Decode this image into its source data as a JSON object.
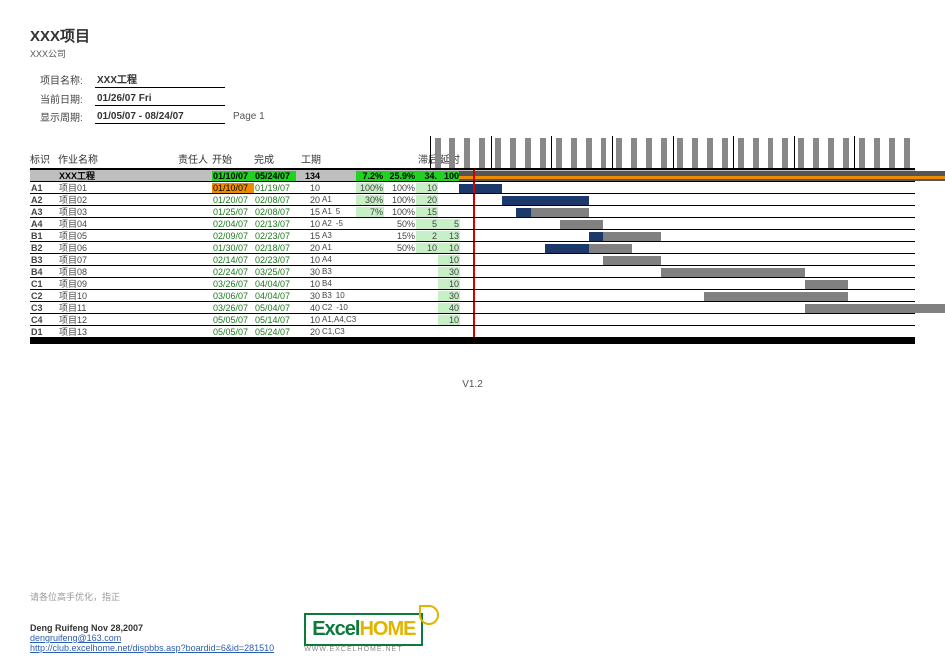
{
  "header": {
    "title": "XXX项目",
    "subtitle": "XXX公司",
    "fields": {
      "project_label": "项目名称:",
      "project_value": "XXX工程",
      "today_label": "当前日期:",
      "today_value": "01/26/07  Fri",
      "range_label": "显示周期:",
      "range_value": "01/05/07 - 08/24/07",
      "page": "Page 1"
    }
  },
  "columns": {
    "id": "标识",
    "name": "作业名称",
    "res": "责任人",
    "start": "开始",
    "end": "完成",
    "dur": "工期",
    "dep": "",
    "plan": "",
    "act": "",
    "rem": "滞后",
    "late": "延时"
  },
  "summary": {
    "name": "XXX工程",
    "start": "01/10/07",
    "end": "05/24/07",
    "dur": "134",
    "plan": "7.2%",
    "act": "25.9%",
    "rem": "34.",
    "late": "100"
  },
  "rows": [
    {
      "id": "A1",
      "name": "项目01",
      "start": "01/10/07",
      "end": "01/19/07",
      "dur": "10",
      "dep": "",
      "plan": "100%",
      "act": "100%",
      "rem": "10",
      "late": "",
      "orange_start": true,
      "bar_s": 2,
      "bar_e": 5,
      "done": 5
    },
    {
      "id": "A2",
      "name": "项目02",
      "start": "01/20/07",
      "end": "02/08/07",
      "dur": "20",
      "dep": "A1",
      "plan": "30%",
      "act": "100%",
      "rem": "20",
      "late": "",
      "bar_s": 5,
      "bar_e": 11,
      "done": 11
    },
    {
      "id": "A3",
      "name": "项目03",
      "start": "01/25/07",
      "end": "02/08/07",
      "dur": "15",
      "dep": "A1",
      "plan": "7%",
      "sub": "5",
      "act": "100%",
      "rem": "15",
      "late": "",
      "bar_s": 6,
      "bar_e": 11,
      "done": 7
    },
    {
      "id": "A4",
      "name": "项目04",
      "start": "02/04/07",
      "end": "02/13/07",
      "dur": "10",
      "dep": "A2",
      "sub": "-5",
      "plan": "",
      "act": "50%",
      "rem": "5",
      "late": "5",
      "bar_s": 9,
      "bar_e": 12,
      "done": 0
    },
    {
      "id": "B1",
      "name": "项目05",
      "start": "02/09/07",
      "end": "02/23/07",
      "dur": "15",
      "dep": "A3",
      "plan": "",
      "act": "15%",
      "rem": "2",
      "late": "13",
      "bar_s": 11,
      "bar_e": 16,
      "done": 11,
      "done_e": 12
    },
    {
      "id": "B2",
      "name": "项目06",
      "start": "01/30/07",
      "end": "02/18/07",
      "dur": "20",
      "dep": "A1",
      "plan": "",
      "act": "50%",
      "rem": "10",
      "late": "10",
      "bar_s": 8,
      "bar_e": 14,
      "done": 8,
      "done_e": 11
    },
    {
      "id": "B3",
      "name": "项目07",
      "start": "02/14/07",
      "end": "02/23/07",
      "dur": "10",
      "dep": "A4",
      "plan": "",
      "act": "",
      "rem": "",
      "late": "10",
      "bar_s": 12,
      "bar_e": 16
    },
    {
      "id": "B4",
      "name": "项目08",
      "start": "02/24/07",
      "end": "03/25/07",
      "dur": "30",
      "dep": "B3",
      "plan": "",
      "act": "",
      "rem": "",
      "late": "30",
      "bar_s": 16,
      "bar_e": 26
    },
    {
      "id": "C1",
      "name": "项目09",
      "start": "03/26/07",
      "end": "04/04/07",
      "dur": "10",
      "dep": "B4",
      "plan": "",
      "act": "",
      "rem": "",
      "late": "10",
      "bar_s": 26,
      "bar_e": 29
    },
    {
      "id": "C2",
      "name": "项目10",
      "start": "03/06/07",
      "end": "04/04/07",
      "dur": "30",
      "dep": "B3",
      "sub": "10",
      "plan": "",
      "act": "",
      "rem": "",
      "late": "30",
      "bar_s": 19,
      "bar_e": 29
    },
    {
      "id": "C3",
      "name": "项目11",
      "start": "03/26/07",
      "end": "05/04/07",
      "dur": "40",
      "dep": "C2",
      "sub": "-10",
      "plan": "",
      "act": "",
      "rem": "",
      "late": "40",
      "bar_s": 26,
      "bar_e": 40
    },
    {
      "id": "C4",
      "name": "项目12",
      "start": "05/05/07",
      "end": "05/14/07",
      "dur": "10",
      "dep": "A1,A4,C3",
      "plan": "",
      "act": "",
      "rem": "",
      "late": "10",
      "bar_s": 40,
      "bar_e": 43
    },
    {
      "id": "D1",
      "name": "项目13",
      "start": "05/05/07",
      "end": "05/24/07",
      "dur": "20",
      "dep": "C1,C3",
      "plan": "",
      "act": "",
      "rem": "",
      "late": "",
      "bar_s": 40,
      "bar_e": 47
    }
  ],
  "gantt": {
    "start_week": 0,
    "total_weeks": 34,
    "today_week": 3.0,
    "sum_s": 2,
    "sum_e": 47,
    "sum_line_e": 37
  },
  "footer": {
    "version": "V1.2",
    "note": "请各位高手优化，指正",
    "author": "Deng Ruifeng  Nov 28,2007",
    "email": "dengruifeng@163.com",
    "link": "http://club.excelhome.net/dispbbs.asp?boardid=6&id=281510",
    "logo_text1": "Excel",
    "logo_text2": "HOME",
    "logo_sub": "WWW.EXCELHOME.NET"
  },
  "chart_data": {
    "type": "gantt",
    "title": "XXX项目 – XXX工程",
    "date_range": [
      "2007-01-05",
      "2007-08-24"
    ],
    "status_date": "2007-01-26",
    "project_summary": {
      "name": "XXX工程",
      "start": "2007-01-10",
      "finish": "2007-05-24",
      "duration_days": 134,
      "planned_pct": 7.2,
      "actual_pct": 25.9
    },
    "tasks": [
      {
        "id": "A1",
        "name": "项目01",
        "start": "2007-01-10",
        "finish": "2007-01-19",
        "duration": 10,
        "predecessors": [],
        "planned_pct": 100,
        "actual_pct": 100,
        "remaining": 10,
        "delay": 0
      },
      {
        "id": "A2",
        "name": "项目02",
        "start": "2007-01-20",
        "finish": "2007-02-08",
        "duration": 20,
        "predecessors": [
          "A1"
        ],
        "planned_pct": 30,
        "actual_pct": 100,
        "remaining": 20,
        "delay": 0
      },
      {
        "id": "A3",
        "name": "项目03",
        "start": "2007-01-25",
        "finish": "2007-02-08",
        "duration": 15,
        "predecessors": [
          "A1"
        ],
        "lag": 5,
        "planned_pct": 7,
        "actual_pct": 100,
        "remaining": 15,
        "delay": 0
      },
      {
        "id": "A4",
        "name": "项目04",
        "start": "2007-02-04",
        "finish": "2007-02-13",
        "duration": 10,
        "predecessors": [
          "A2"
        ],
        "lag": -5,
        "actual_pct": 50,
        "remaining": 5,
        "delay": 5
      },
      {
        "id": "B1",
        "name": "项目05",
        "start": "2007-02-09",
        "finish": "2007-02-23",
        "duration": 15,
        "predecessors": [
          "A3"
        ],
        "actual_pct": 15,
        "remaining": 2,
        "delay": 13
      },
      {
        "id": "B2",
        "name": "项目06",
        "start": "2007-01-30",
        "finish": "2007-02-18",
        "duration": 20,
        "predecessors": [
          "A1"
        ],
        "actual_pct": 50,
        "remaining": 10,
        "delay": 10
      },
      {
        "id": "B3",
        "name": "项目07",
        "start": "2007-02-14",
        "finish": "2007-02-23",
        "duration": 10,
        "predecessors": [
          "A4"
        ],
        "delay": 10
      },
      {
        "id": "B4",
        "name": "项目08",
        "start": "2007-02-24",
        "finish": "2007-03-25",
        "duration": 30,
        "predecessors": [
          "B3"
        ],
        "delay": 30
      },
      {
        "id": "C1",
        "name": "项目09",
        "start": "2007-03-26",
        "finish": "2007-04-04",
        "duration": 10,
        "predecessors": [
          "B4"
        ],
        "delay": 10
      },
      {
        "id": "C2",
        "name": "项目10",
        "start": "2007-03-06",
        "finish": "2007-04-04",
        "duration": 30,
        "predecessors": [
          "B3"
        ],
        "lag": 10,
        "delay": 30
      },
      {
        "id": "C3",
        "name": "项目11",
        "start": "2007-03-26",
        "finish": "2007-05-04",
        "duration": 40,
        "predecessors": [
          "C2"
        ],
        "lag": -10,
        "delay": 40
      },
      {
        "id": "C4",
        "name": "项目12",
        "start": "2007-05-05",
        "finish": "2007-05-14",
        "duration": 10,
        "predecessors": [
          "A1",
          "A4",
          "C3"
        ],
        "delay": 10
      },
      {
        "id": "D1",
        "name": "项目13",
        "start": "2007-05-05",
        "finish": "2007-05-24",
        "duration": 20,
        "predecessors": [
          "C1",
          "C3"
        ]
      }
    ]
  }
}
